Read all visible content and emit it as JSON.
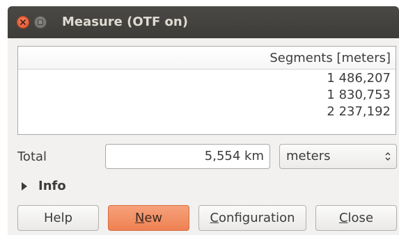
{
  "window": {
    "title": "Measure (OTF on)",
    "titlebar_color": "#3d3c38",
    "close_button_color": "#e0512b"
  },
  "table": {
    "header": "Segments [meters]",
    "rows": [
      "1 486,207",
      "1 830,753",
      "2 237,192"
    ]
  },
  "total": {
    "label": "Total",
    "value": "5,554 km",
    "unit": "meters"
  },
  "info": {
    "label": "Info",
    "expanded": false,
    "icon": "triangle-right-icon"
  },
  "buttons": {
    "help": {
      "label": "Help"
    },
    "new": {
      "mnemonic": "N",
      "rest": "ew",
      "accent": "#ef8152"
    },
    "configuration": {
      "mnemonic": "C",
      "rest": "onfiguration"
    },
    "close": {
      "mnemonic": "C",
      "rest": "lose"
    }
  }
}
